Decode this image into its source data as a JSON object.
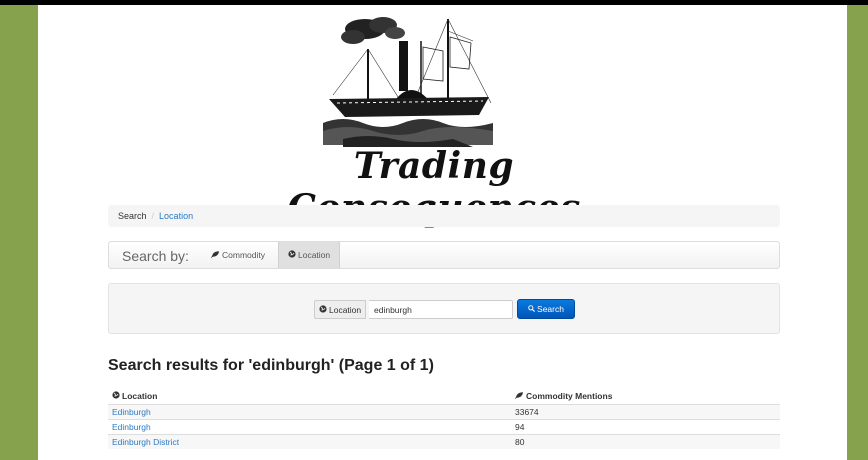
{
  "site": {
    "title": "Trading Consequences"
  },
  "breadcrumb": {
    "first": "Search",
    "separator": "/",
    "current": "Location"
  },
  "search_by": {
    "label": "Search by:",
    "tabs": [
      {
        "label": "Commodity",
        "icon": "leaf-icon"
      },
      {
        "label": "Location",
        "icon": "globe-icon",
        "active": true
      }
    ]
  },
  "search": {
    "addon_label": "Location",
    "value": "edinburgh",
    "button_label": "Search"
  },
  "results": {
    "heading": "Search results for 'edinburgh' (Page 1 of 1)",
    "columns": [
      "Location",
      "Commodity Mentions"
    ],
    "rows": [
      {
        "location": "Edinburgh",
        "mentions": "33674"
      },
      {
        "location": "Edinburgh",
        "mentions": "94"
      },
      {
        "location": "Edinburgh District",
        "mentions": "80"
      }
    ]
  },
  "colors": {
    "side_green": "#87a24d",
    "link_blue": "#2a7ac6",
    "button_blue": "#0a6fd6"
  }
}
